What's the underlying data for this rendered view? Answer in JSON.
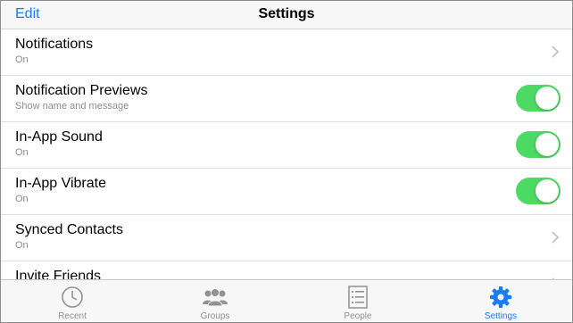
{
  "nav": {
    "edit_label": "Edit",
    "title": "Settings"
  },
  "rows": [
    {
      "label": "Notifications",
      "sub": "On",
      "control": "chevron"
    },
    {
      "label": "Notification Previews",
      "sub": "Show name and message",
      "control": "toggle",
      "on": true
    },
    {
      "label": "In-App Sound",
      "sub": "On",
      "control": "toggle",
      "on": true
    },
    {
      "label": "In-App Vibrate",
      "sub": "On",
      "control": "toggle",
      "on": true
    },
    {
      "label": "Synced Contacts",
      "sub": "On",
      "control": "chevron"
    },
    {
      "label": "Invite Friends",
      "sub": "",
      "control": "chevron"
    }
  ],
  "tabs": [
    {
      "label": "Recent",
      "icon": "clock-icon",
      "active": false
    },
    {
      "label": "Groups",
      "icon": "groups-icon",
      "active": false
    },
    {
      "label": "People",
      "icon": "people-list-icon",
      "active": false
    },
    {
      "label": "Settings",
      "icon": "gear-icon",
      "active": true
    }
  ],
  "colors": {
    "accent": "#1a7cf5",
    "toggle_on": "#4cd964",
    "inactive_tab": "#929292"
  }
}
